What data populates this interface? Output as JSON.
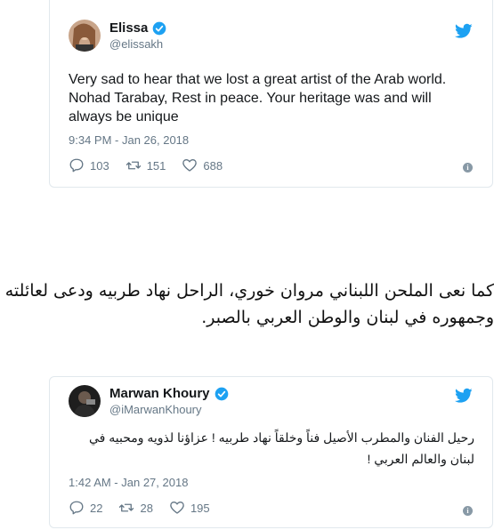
{
  "tweets": [
    {
      "name": "Elissa",
      "handle": "@elissakh",
      "text": "Very sad to hear that we lost a great artist of the Arab world. Nohad Tarabay, Rest in peace. Your heritage was and will always be unique",
      "timestamp": "9:34 PM - Jan 26, 2018",
      "replies": "103",
      "retweets": "151",
      "likes": "688"
    },
    {
      "name": "Marwan Khoury",
      "handle": "@iMarwanKhoury",
      "text": "رحيل الفنان والمطرب الأصيل فناً وخلقاً نهاد طربيه ! عزاؤنا لذويه ومحبيه في لبنان والعالم العربي !",
      "timestamp": "1:42 AM - Jan 27, 2018",
      "replies": "22",
      "retweets": "28",
      "likes": "195"
    }
  ],
  "article": {
    "paragraph": "كما نعى الملحن اللبناني مروان خوري، الراحل نهاد طربيه ودعى لعائلته وجمهوره في لبنان والوطن العربي بالصبر."
  },
  "colors": {
    "twitter_blue": "#1da1f2",
    "muted": "#657786",
    "border": "#e1e8ed"
  }
}
